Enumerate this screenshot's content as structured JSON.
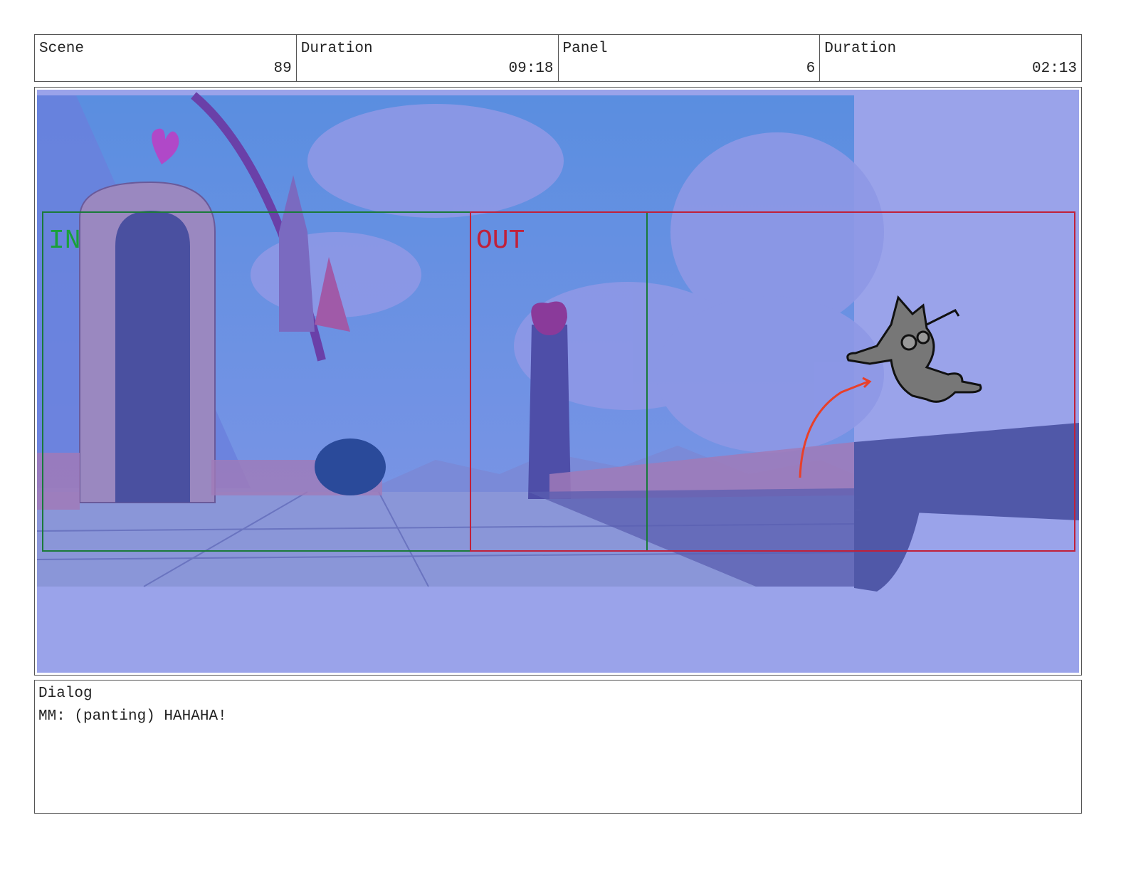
{
  "header": {
    "scene": {
      "label": "Scene",
      "value": "89"
    },
    "scene_duration": {
      "label": "Duration",
      "value": "09:18"
    },
    "panel": {
      "label": "Panel",
      "value": "6"
    },
    "panel_duration": {
      "label": "Duration",
      "value": "02:13"
    }
  },
  "panel_image": {
    "in_label": "IN",
    "out_label": "OUT",
    "colors": {
      "in_box": "#1a7a3a",
      "out_box": "#c0203a",
      "background": "#9aa3ea",
      "motion_arrow": "#e8402a"
    }
  },
  "dialog": {
    "label": "Dialog",
    "text": "MM: (panting) HAHAHA!"
  }
}
